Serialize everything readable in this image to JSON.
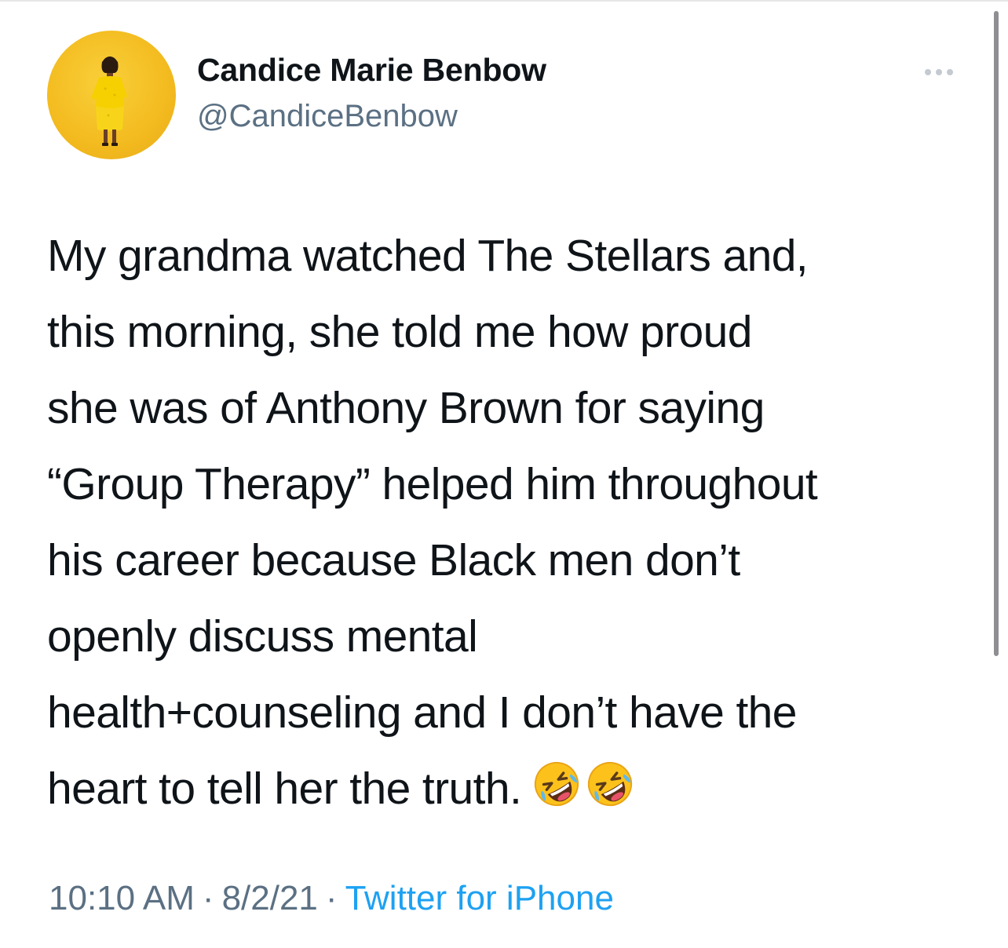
{
  "tweet": {
    "author": {
      "display_name": "Candice Marie Benbow",
      "handle": "@CandiceBenbow",
      "avatar_icon": "profile-photo-yellow-background"
    },
    "more_icon": "more-horizontal-icon",
    "text_lines": [
      "My grandma watched The Stellars and,",
      "this morning, she told me how proud",
      "she was of Anthony Brown for saying",
      "“Group Therapy” helped him throughout",
      "his career because Black men don’t",
      "openly discuss mental",
      "health+counseling and I don’t have the",
      "heart to tell her the truth."
    ],
    "emojis": [
      "rolling-on-the-floor-laughing-emoji",
      "rolling-on-the-floor-laughing-emoji"
    ],
    "meta": {
      "time": "10:10 AM",
      "separator": "·",
      "date": "8/2/21",
      "source": "Twitter for iPhone"
    }
  },
  "colors": {
    "text_primary": "#0f1419",
    "text_secondary": "#5b7083",
    "link_blue": "#1da1f2",
    "avatar_yellow": "#f3bb1f"
  }
}
